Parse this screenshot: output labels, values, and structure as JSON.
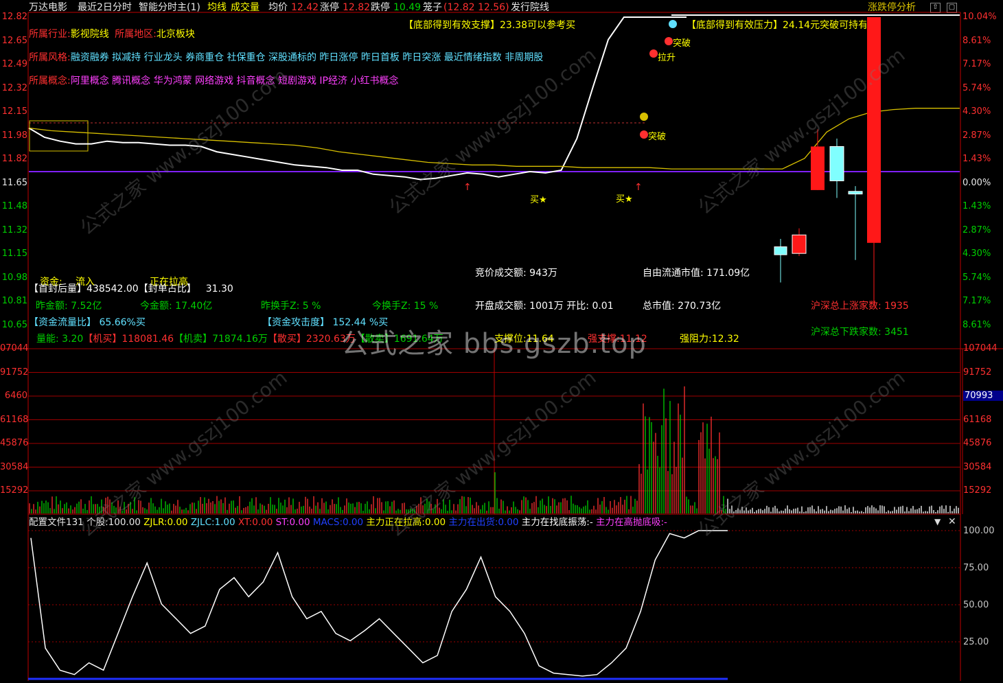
{
  "colors": {
    "up": "#ff3030",
    "down": "#00c000",
    "white": "#ffffff",
    "yellow": "#ffff00",
    "cyan": "#60e0ff",
    "magenta": "#ff40ff",
    "purple": "#8020ff",
    "red_line": "#c00000"
  },
  "topbar": {
    "stock_name": "万达电影",
    "period": "最近2日分时",
    "indicator": "智能分时主(1)",
    "ma_line": "均线",
    "volume": "成交量",
    "avg_label": "均价",
    "avg_value": "12.42",
    "limit_up_label": "涨停",
    "limit_up_value": "12.82",
    "limit_down_label": "跌停",
    "limit_down_value": "10.49",
    "cage_label": "笼子",
    "cage_value": "(12.82 12.56)",
    "issue_line": "发行院线",
    "right_btn": "涨跌停分析"
  },
  "info": {
    "industry_label": "所属行业:",
    "industry": "影视院线",
    "region_label": "所属地区:",
    "region": "北京板块",
    "style_label": "所属风格:",
    "style": "融资融券 拟减持 行业龙头 券商重仓 社保重仓 深股通标的 昨日涨停 昨日首板 昨日突涨 最近情绪指数 非周期股",
    "concept_label": "所属概念:",
    "concept": "阿里概念 腾讯概念 华为鸿蒙 网络游戏 抖音概念 短剧游戏 IP经济 小红书概念",
    "support_text": "【底部得到有效支撑】23.38可以参考买",
    "pressure_text": "【底部得到有效压力】24.14元突破可持有"
  },
  "panel": {
    "fund_label": "资金:",
    "fund_value": "流入",
    "pulling": "正在拉高",
    "seal_label": "【首封后量】",
    "seal_value": "438542.00",
    "seal_ratio_label": "【封单占比】",
    "seal_ratio_value": "31.30",
    "prev_amt_label": "昨金额:",
    "prev_amt": "7.52亿",
    "cur_amt_label": "今金额:",
    "cur_amt": "17.40亿",
    "prev_turn_label": "昨换手Z:",
    "prev_turn": "5 %",
    "cur_turn_label": "今换手Z:",
    "cur_turn": "15 %",
    "flow_ratio_label": "【资金流量比】",
    "flow_ratio": "65.66%买",
    "attack_label": "【资金攻击度】",
    "attack": "152.44 %买",
    "vol_ratio_label": "量能:",
    "vol_ratio": "3.20",
    "inst_buy_label": "【机买】",
    "inst_buy": "118081.46",
    "inst_sell_label": "【机卖】",
    "inst_sell": "71874.16万",
    "retail_buy_label": "【散买】",
    "retail_buy": "2320.63万",
    "retail_sell_label": "【散卖】",
    "retail_sell": "1691.64万",
    "support_label": "支撑位:",
    "support": "11.64",
    "strong_support_label": "强支撑:",
    "strong_support": "11.12",
    "resist_label": "强阻力:",
    "resist": "12.32",
    "auction_amt_label": "竞价成交额:",
    "auction_amt": "943万",
    "open_amt_label": "开盘成交额:",
    "open_amt": "1001万",
    "open_ratio_label": "开比:",
    "open_ratio": "0.01",
    "float_cap_label": "自由流通市值:",
    "float_cap": "171.09亿",
    "total_cap_label": "总市值:",
    "total_cap": "270.73亿",
    "up_count_label": "沪深总上涨家数:",
    "up_count": "1935",
    "down_count_label": "沪深总下跌家数:",
    "down_count": "3451"
  },
  "price_axis_left": [
    "12.82",
    "12.65",
    "12.49",
    "12.32",
    "12.15",
    "11.98",
    "11.82",
    "11.65",
    "11.48",
    "11.32",
    "11.15",
    "10.98",
    "10.81",
    "10.65"
  ],
  "pct_axis_right": [
    "10.04%",
    "8.61%",
    "7.17%",
    "5.74%",
    "4.30%",
    "2.87%",
    "1.43%",
    "0.00%",
    "1.43%",
    "2.87%",
    "4.30%",
    "5.74%",
    "7.17%",
    "8.61%"
  ],
  "vol_axis_left": [
    "07044",
    "91752",
    "6460",
    "61168",
    "45876",
    "30584",
    "15292"
  ],
  "vol_axis_right": [
    "107044",
    "91752",
    "70993",
    "61168",
    "45876",
    "30584",
    "15292"
  ],
  "markers": {
    "buy": "买",
    "breakout": "突破",
    "pull_up": "拉升"
  },
  "indicator_bar": {
    "config": "配置文件131",
    "stock_label": "个股:",
    "stock_value": "100.00",
    "zjlr_label": "ZJLR:",
    "zjlr": "0.00",
    "zjlc_label": "ZJLC:",
    "zjlc": "1.00",
    "xt_label": "XT:",
    "xt": "0.00",
    "st_label": "ST:",
    "st": "0.00",
    "macs_label": "MACS:",
    "macs": "0.00",
    "main_up_label": "主力正在拉高:",
    "main_up": "0.00",
    "main_out_label": "主力在出货:",
    "main_out": "0.00",
    "main_bottom_label": "主力在找底振荡:",
    "main_bottom": "-",
    "main_high_label": "主力在高抛底吸:",
    "main_high": "-"
  },
  "osc_axis_right": [
    "100.00",
    "75.00",
    "50.00",
    "25.00"
  ],
  "watermark": {
    "center": "公式之家 bbs.gszb.top",
    "diag": "公式之家 www.gszj100.com"
  },
  "chart_data": {
    "type": "line",
    "title": "",
    "price_range": [
      10.49,
      12.82
    ],
    "prev_close": 11.65,
    "intraday_price": [
      11.98,
      11.91,
      11.88,
      11.86,
      11.86,
      11.88,
      11.87,
      11.87,
      11.86,
      11.85,
      11.85,
      11.84,
      11.8,
      11.78,
      11.76,
      11.74,
      11.72,
      11.7,
      11.69,
      11.68,
      11.66,
      11.66,
      11.63,
      11.62,
      11.61,
      11.59,
      11.6,
      11.62,
      11.64,
      11.63,
      11.61,
      11.63,
      11.65,
      11.64,
      11.66,
      11.9,
      12.28,
      12.65,
      12.82,
      12.82,
      12.82,
      12.82,
      12.82
    ],
    "avg_price": [
      11.98,
      11.96,
      11.95,
      11.94,
      11.93,
      11.92,
      11.91,
      11.9,
      11.89,
      11.88,
      11.87,
      11.86,
      11.85,
      11.83,
      11.8,
      11.78,
      11.76,
      11.74,
      11.72,
      11.71,
      11.7,
      11.7,
      11.69,
      11.69,
      11.69,
      11.68,
      11.68,
      11.68,
      11.68,
      11.67,
      11.67,
      11.67,
      11.67,
      11.67,
      11.67,
      11.75,
      11.95,
      12.05,
      12.1,
      12.12,
      12.13,
      12.13,
      12.13
    ],
    "candles": [
      {
        "open": 11.08,
        "close": 11.02,
        "high": 11.14,
        "low": 10.81
      },
      {
        "open": 11.03,
        "close": 11.17,
        "high": 11.22,
        "low": 11.01
      },
      {
        "open": 11.51,
        "close": 11.84,
        "high": 11.97,
        "low": 11.51
      },
      {
        "open": 11.84,
        "close": 11.58,
        "high": 11.9,
        "low": 11.45
      },
      {
        "open": 11.5,
        "close": 11.48,
        "high": 11.54,
        "low": 10.98
      },
      {
        "open": 11.11,
        "close": 12.82,
        "high": 12.82,
        "low": 10.62
      }
    ],
    "osc_values": [
      95,
      20,
      5,
      2,
      10,
      5,
      30,
      55,
      78,
      50,
      40,
      30,
      35,
      60,
      68,
      55,
      65,
      85,
      55,
      40,
      45,
      30,
      25,
      32,
      40,
      30,
      20,
      10,
      15,
      45,
      60,
      82,
      55,
      45,
      30,
      8,
      3,
      2,
      1,
      2,
      10,
      20,
      45,
      80,
      98,
      95,
      100,
      100,
      100
    ]
  }
}
